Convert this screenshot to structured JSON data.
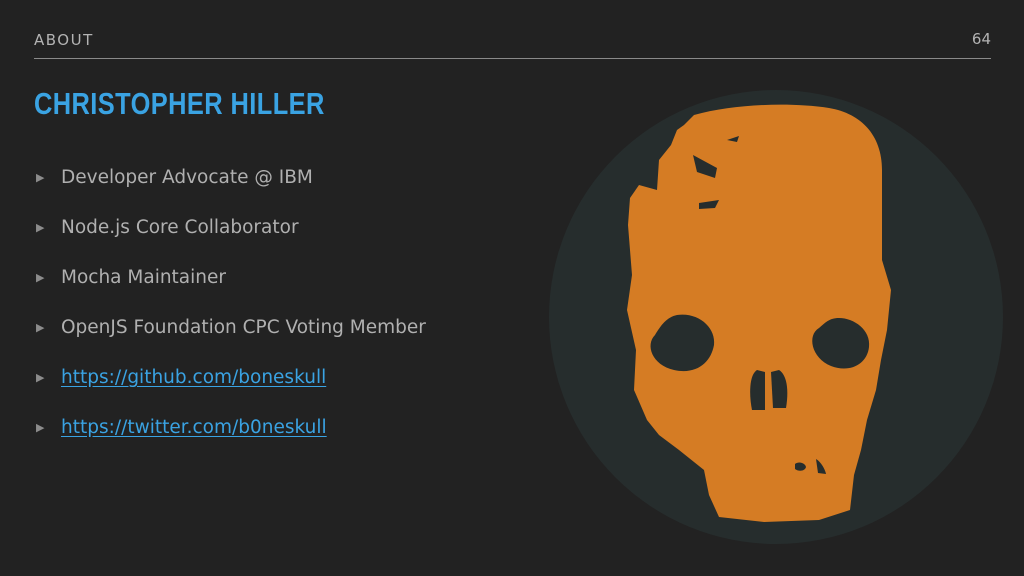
{
  "header": {
    "section": "ABOUT",
    "page_number": "64"
  },
  "title": "CHRISTOPHER HILLER",
  "bullets": [
    {
      "text": "Developer Advocate @ IBM",
      "link": false
    },
    {
      "text": "Node.js Core Collaborator",
      "link": false
    },
    {
      "text": "Mocha Maintainer",
      "link": false
    },
    {
      "text": "OpenJS Foundation CPC Voting Member",
      "link": false
    },
    {
      "text": "https://github.com/boneskull",
      "link": true
    },
    {
      "text": "https://twitter.com/b0neskull",
      "link": true
    }
  ],
  "avatar": {
    "icon": "skull-icon",
    "circle_color": "#262d2d",
    "skull_color": "#d57c24"
  },
  "colors": {
    "background": "#222222",
    "accent": "#3aa3e3",
    "text": "#b0b0b0"
  }
}
